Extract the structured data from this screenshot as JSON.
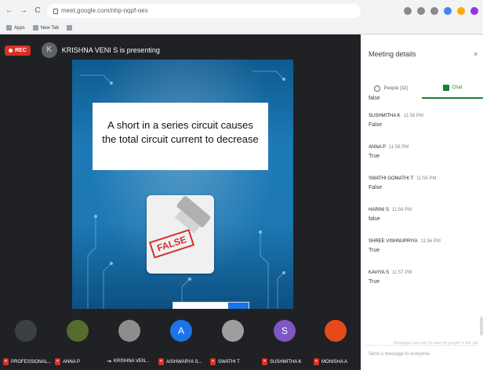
{
  "browser": {
    "nav": [
      "←",
      "→",
      "C"
    ],
    "url": "meet.google.com/nhp-nqpf-oex",
    "bookmarks": [
      {
        "label": "Apps"
      },
      {
        "label": "New Tab"
      },
      {
        "label": ""
      }
    ],
    "ext_colors": [
      "#8a8a8a",
      "#8a8a8a",
      "#8a8a8a",
      "#4285f4",
      "#f9ab00",
      "#9334e6"
    ]
  },
  "top": {
    "rec_label": "REC",
    "presenter_initial": "K",
    "presenting_text": "KRISHNA VENI S is presenting"
  },
  "slide": {
    "statement": "A short in a series circuit causes the total circuit current to decrease",
    "stamp": "FALSE"
  },
  "participants": [
    {
      "name": "PROFESSIONAL...",
      "initial": "",
      "color": "#3c4043"
    },
    {
      "name": "ANNA P",
      "initial": "",
      "color": "#556b2f"
    },
    {
      "name": "KRISHNA VEN...",
      "initial": "",
      "color": "#8d8d8d"
    },
    {
      "name": "AISHWARYA S...",
      "initial": "A",
      "color": "#1a73e8"
    },
    {
      "name": "SWATHI T",
      "initial": "",
      "color": "#9e9e9e"
    },
    {
      "name": "SUSHMITHA K",
      "initial": "S",
      "color": "#7e57c2"
    },
    {
      "name": "MONISHA A",
      "initial": "",
      "color": "#e64a19"
    }
  ],
  "panel": {
    "title": "Meeting details",
    "close": "×",
    "tab_people": "People (32)",
    "tab_chat": "Chat",
    "messages": [
      {
        "sender": "",
        "time": "",
        "text": "false"
      },
      {
        "sender": "SUSHMITHA K",
        "time": "11:56 PM",
        "text": "False"
      },
      {
        "sender": "ANNA P",
        "time": "11:56 PM",
        "text": "True"
      },
      {
        "sender": "SWATHI GOMATHI T",
        "time": "11:56 PM",
        "text": "False"
      },
      {
        "sender": "HARINI S",
        "time": "11:56 PM",
        "text": "false"
      },
      {
        "sender": "SHREE VISHNUPRIYA",
        "time": "11:56 PM",
        "text": "True"
      },
      {
        "sender": "KAVIYA S",
        "time": "11:57 PM",
        "text": "True"
      }
    ],
    "input_hint": "Send a message to everyone",
    "input_meta": "Messages can only be seen by people in the call"
  }
}
